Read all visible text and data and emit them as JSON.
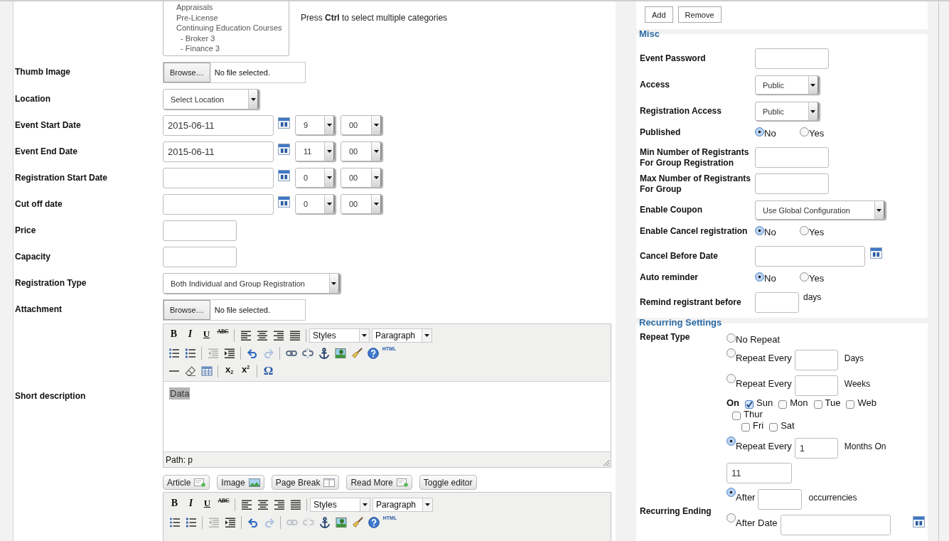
{
  "categories": {
    "options": [
      {
        "label": "Appraisals"
      },
      {
        "label": "Pre-License"
      },
      {
        "label": "Continuing Education Courses",
        "children": [
          {
            "label": "- Broker 3"
          },
          {
            "label": "- Finance 3"
          }
        ]
      }
    ],
    "hint": "Press **Ctrl** to select multiple categories"
  },
  "event_fields": [
    {
      "kind": "file",
      "label": "Thumb Image",
      "button": "Browse…",
      "status": "No file selected."
    },
    {
      "kind": "select",
      "label": "Location",
      "value": "Select Location"
    },
    {
      "kind": "datetime",
      "label": "Event Start Date",
      "date": "2015-06-11",
      "hour": "9",
      "minute": "00"
    },
    {
      "kind": "datetime",
      "label": "Event End Date",
      "date": "2015-06-11",
      "hour": "11",
      "minute": "00"
    },
    {
      "kind": "datetime",
      "label": "Registration Start Date",
      "hour": "0",
      "minute": "00"
    },
    {
      "kind": "datetime",
      "label": "Cut off date",
      "hour": "0",
      "minute": "00"
    },
    {
      "kind": "text",
      "label": "Price"
    },
    {
      "kind": "text",
      "label": "Capacity"
    },
    {
      "kind": "select",
      "label": "Registration Type",
      "value": "Both Individual and Group Registration"
    },
    {
      "kind": "file",
      "label": "Attachment",
      "button": "Browse…",
      "status": "No file selected."
    }
  ],
  "short_description": {
    "label": "Short description",
    "toolbar": [
      [
        [
          {
            "kind": "bold",
            "label": "B",
            "disabled": false
          },
          {
            "kind": "italic",
            "label": "I",
            "disabled": false
          },
          {
            "kind": "underline",
            "label": "U",
            "disabled": false
          },
          {
            "kind": "strike",
            "label": "ABC",
            "disabled": false
          }
        ],
        [
          {
            "kind": "align-left",
            "disabled": false
          },
          {
            "kind": "align-center",
            "disabled": false
          },
          {
            "kind": "align-right",
            "disabled": false
          },
          {
            "kind": "justify",
            "disabled": false
          }
        ],
        [
          {
            "kind": "dropdown",
            "value": "Styles",
            "disabled": false
          },
          {
            "kind": "dropdown",
            "value": "Paragraph",
            "disabled": false
          }
        ]
      ],
      [
        [
          {
            "kind": "bullets",
            "disabled": false
          },
          {
            "kind": "numbers",
            "disabled": false
          }
        ],
        [
          {
            "kind": "outdent",
            "disabled": true
          },
          {
            "kind": "indent",
            "disabled": false
          }
        ],
        [
          {
            "kind": "undo",
            "disabled": false
          },
          {
            "kind": "redo",
            "disabled": true
          }
        ],
        [
          {
            "kind": "link",
            "disabled": false
          },
          {
            "kind": "unlink",
            "disabled": false
          },
          {
            "kind": "anchor",
            "disabled": false
          },
          {
            "kind": "image",
            "disabled": false
          },
          {
            "kind": "cleanup",
            "disabled": false
          },
          {
            "kind": "help",
            "disabled": false
          },
          {
            "kind": "html",
            "label": "HTML",
            "disabled": false
          }
        ]
      ],
      [
        [
          {
            "kind": "hr",
            "disabled": false
          },
          {
            "kind": "eraser",
            "disabled": false
          },
          {
            "kind": "table",
            "disabled": false
          }
        ],
        [
          {
            "kind": "subscript",
            "label": "x$_{2}$",
            "disabled": false
          },
          {
            "kind": "superscript",
            "label": "x$^{2}$",
            "disabled": false
          }
        ],
        [
          {
            "kind": "charmap",
            "label": "Ω",
            "disabled": false
          }
        ]
      ]
    ],
    "content": {
      "text": "Data",
      "selected": true
    },
    "path": "Path: p"
  },
  "editor_buttons": [
    {
      "kind": "article",
      "label": "Article"
    },
    {
      "kind": "image",
      "label": "Image"
    },
    {
      "kind": "pagebreak",
      "label": "Page Break"
    },
    {
      "kind": "readmore",
      "label": "Read More"
    },
    {
      "kind": "plain",
      "label": "Toggle editor"
    }
  ],
  "editor_2": {
    "toolbar": [
      [
        [
          {
            "kind": "bold",
            "label": "B",
            "disabled": false
          },
          {
            "kind": "italic",
            "label": "I",
            "disabled": false
          },
          {
            "kind": "underline",
            "label": "U",
            "disabled": false
          },
          {
            "kind": "strike",
            "label": "ABC",
            "disabled": false
          }
        ],
        [
          {
            "kind": "align-left",
            "disabled": false
          },
          {
            "kind": "align-center",
            "disabled": false
          },
          {
            "kind": "align-right",
            "disabled": false
          },
          {
            "kind": "justify",
            "disabled": false
          }
        ],
        [
          {
            "kind": "dropdown",
            "value": "Styles",
            "disabled": false
          },
          {
            "kind": "dropdown",
            "value": "Paragraph",
            "disabled": false
          }
        ]
      ],
      [
        [
          {
            "kind": "bullets",
            "disabled": false
          },
          {
            "kind": "numbers",
            "disabled": false
          }
        ],
        [
          {
            "kind": "outdent",
            "disabled": true
          },
          {
            "kind": "indent",
            "disabled": false
          }
        ],
        [
          {
            "kind": "undo",
            "disabled": false
          },
          {
            "kind": "redo",
            "disabled": true
          }
        ],
        [
          {
            "kind": "link",
            "disabled": true
          },
          {
            "kind": "unlink",
            "disabled": true
          },
          {
            "kind": "anchor",
            "disabled": false
          },
          {
            "kind": "image",
            "disabled": false
          },
          {
            "kind": "cleanup",
            "disabled": false
          },
          {
            "kind": "help",
            "disabled": false
          },
          {
            "kind": "html",
            "label": "HTML",
            "disabled": false
          }
        ]
      ]
    ]
  },
  "member_buttons": [
    "Add",
    "Remove"
  ],
  "misc": {
    "title": "Misc",
    "fields": [
      {
        "kind": "text",
        "label": "Event Password"
      },
      {
        "kind": "select",
        "label": "Access",
        "value": "Public"
      },
      {
        "kind": "select",
        "label": "Registration Access",
        "value": "Public"
      },
      {
        "kind": "radio",
        "label": "Published",
        "options": [
          {
            "label": "No",
            "selected": true
          },
          {
            "label": "Yes",
            "selected": false
          }
        ]
      },
      {
        "kind": "text",
        "label": "Min Number of Registrants For Group Registration"
      },
      {
        "kind": "text",
        "label": "Max Number of Registrants For Group"
      },
      {
        "kind": "select",
        "label": "Enable Coupon",
        "value": "Use Global Configuration"
      },
      {
        "kind": "radio",
        "label": "Enable Cancel registration",
        "options": [
          {
            "label": "No",
            "selected": true
          },
          {
            "label": "Yes",
            "selected": false
          }
        ]
      },
      {
        "kind": "date",
        "label": "Cancel Before Date"
      },
      {
        "kind": "radio",
        "label": "Auto reminder",
        "options": [
          {
            "label": "No",
            "selected": true
          },
          {
            "label": "Yes",
            "selected": false
          }
        ]
      },
      {
        "kind": "number",
        "label": "Remind registrant before",
        "unit": "days"
      }
    ]
  },
  "recurring": {
    "title": "Recurring Settings",
    "repeat_type": {
      "label": "Repeat Type",
      "options": [
        {
          "kind": "none",
          "label": "No Repeat",
          "selected": false
        },
        {
          "kind": "interval",
          "label": "Repeat Every",
          "unit": "Days",
          "selected": false
        },
        {
          "kind": "weekly",
          "label": "Repeat Every",
          "unit": "Weeks",
          "selected": false,
          "on_label": "On",
          "days": [
            [
              {
                "label": "Sun",
                "checked": true
              },
              {
                "label": "Mon",
                "checked": false
              },
              {
                "label": "Tue",
                "checked": false
              },
              {
                "label": "Web",
                "checked": false
              },
              {
                "label": "Thur",
                "checked": false
              }
            ],
            [
              {
                "label": "Fri",
                "checked": false
              },
              {
                "label": "Sat",
                "checked": false
              }
            ]
          ]
        },
        {
          "kind": "monthly",
          "label": "Repeat Every",
          "value": "1",
          "unit": "Months On",
          "day": "11",
          "selected": true
        }
      ]
    },
    "ending": {
      "label": "Recurring Ending",
      "options": [
        {
          "kind": "count",
          "label": "After",
          "unit": "occurrencies",
          "selected": true
        },
        {
          "kind": "date",
          "label": "After Date",
          "selected": false
        }
      ]
    }
  }
}
